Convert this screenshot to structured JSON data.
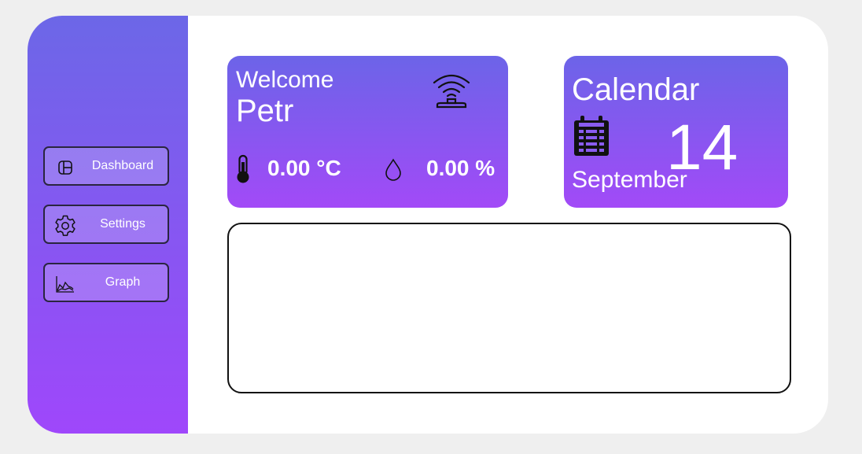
{
  "sidebar": {
    "items": [
      {
        "label": "Dashboard",
        "icon": "dashboard-icon"
      },
      {
        "label": "Settings",
        "icon": "gear-icon"
      },
      {
        "label": "Graph",
        "icon": "graph-icon"
      }
    ]
  },
  "welcome": {
    "greeting": "Welcome",
    "name": "Petr",
    "temperature": "0.00 °C",
    "humidity": "0.00 %",
    "signal_icon": "wifi-signal-icon"
  },
  "calendar": {
    "title": "Calendar",
    "day": "14",
    "month": "September",
    "icon": "calendar-icon"
  },
  "colors": {
    "sidebar_top": "#6c67e7",
    "sidebar_bottom": "#9f47fb",
    "card_top": "#6c64e8",
    "card_bottom": "#a24af7"
  }
}
